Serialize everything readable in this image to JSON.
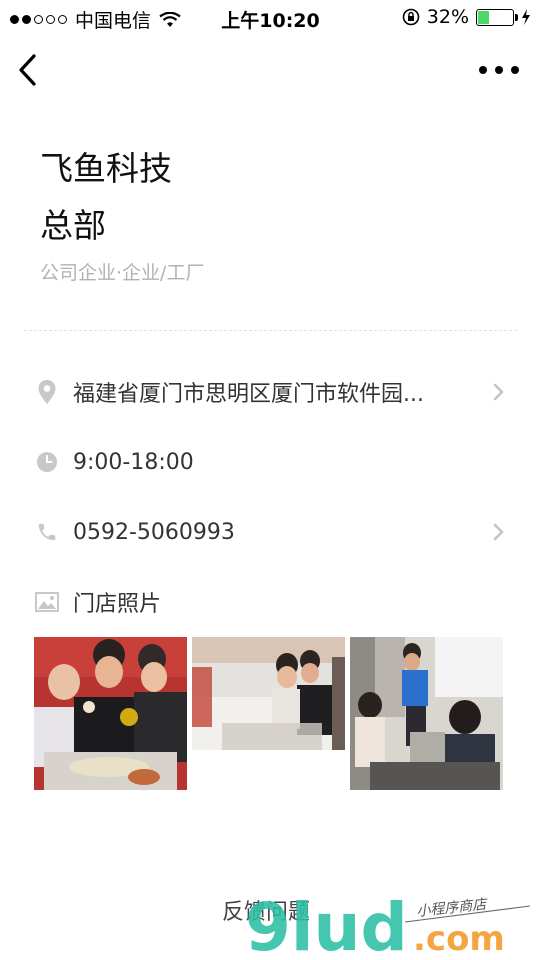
{
  "status": {
    "carrier": "中国电信",
    "time": "上午10:20",
    "battery": "32%",
    "battery_level": 0.32,
    "signal_full": 2,
    "signal_total": 5
  },
  "store": {
    "name_line1": "飞鱼科技",
    "name_line2": "总部",
    "category": "公司企业·企业/工厂"
  },
  "info": {
    "address": "福建省厦门市思明区厦门市软件园...",
    "hours": "9:00-18:00",
    "phone": "0592-5060993",
    "photos_label": "门店照片"
  },
  "icons": {
    "back": "chevron-left-icon",
    "more": "more-dots-icon",
    "address": "location-pin-icon",
    "hours": "clock-icon",
    "phone": "phone-icon",
    "photos": "image-icon",
    "chevron": "chevron-right-icon"
  },
  "footer": {
    "feedback": "反馈问题"
  },
  "watermark": {
    "brand": "9lud",
    "domain": ".com",
    "tagline": "小程序商店"
  },
  "colors": {
    "icon_gray": "#c8c8c8",
    "muted_text": "#b2b2b2",
    "battery_green": "#4cd964",
    "watermark_teal": "#2bbfa4",
    "watermark_orange": "#f39c2e"
  }
}
